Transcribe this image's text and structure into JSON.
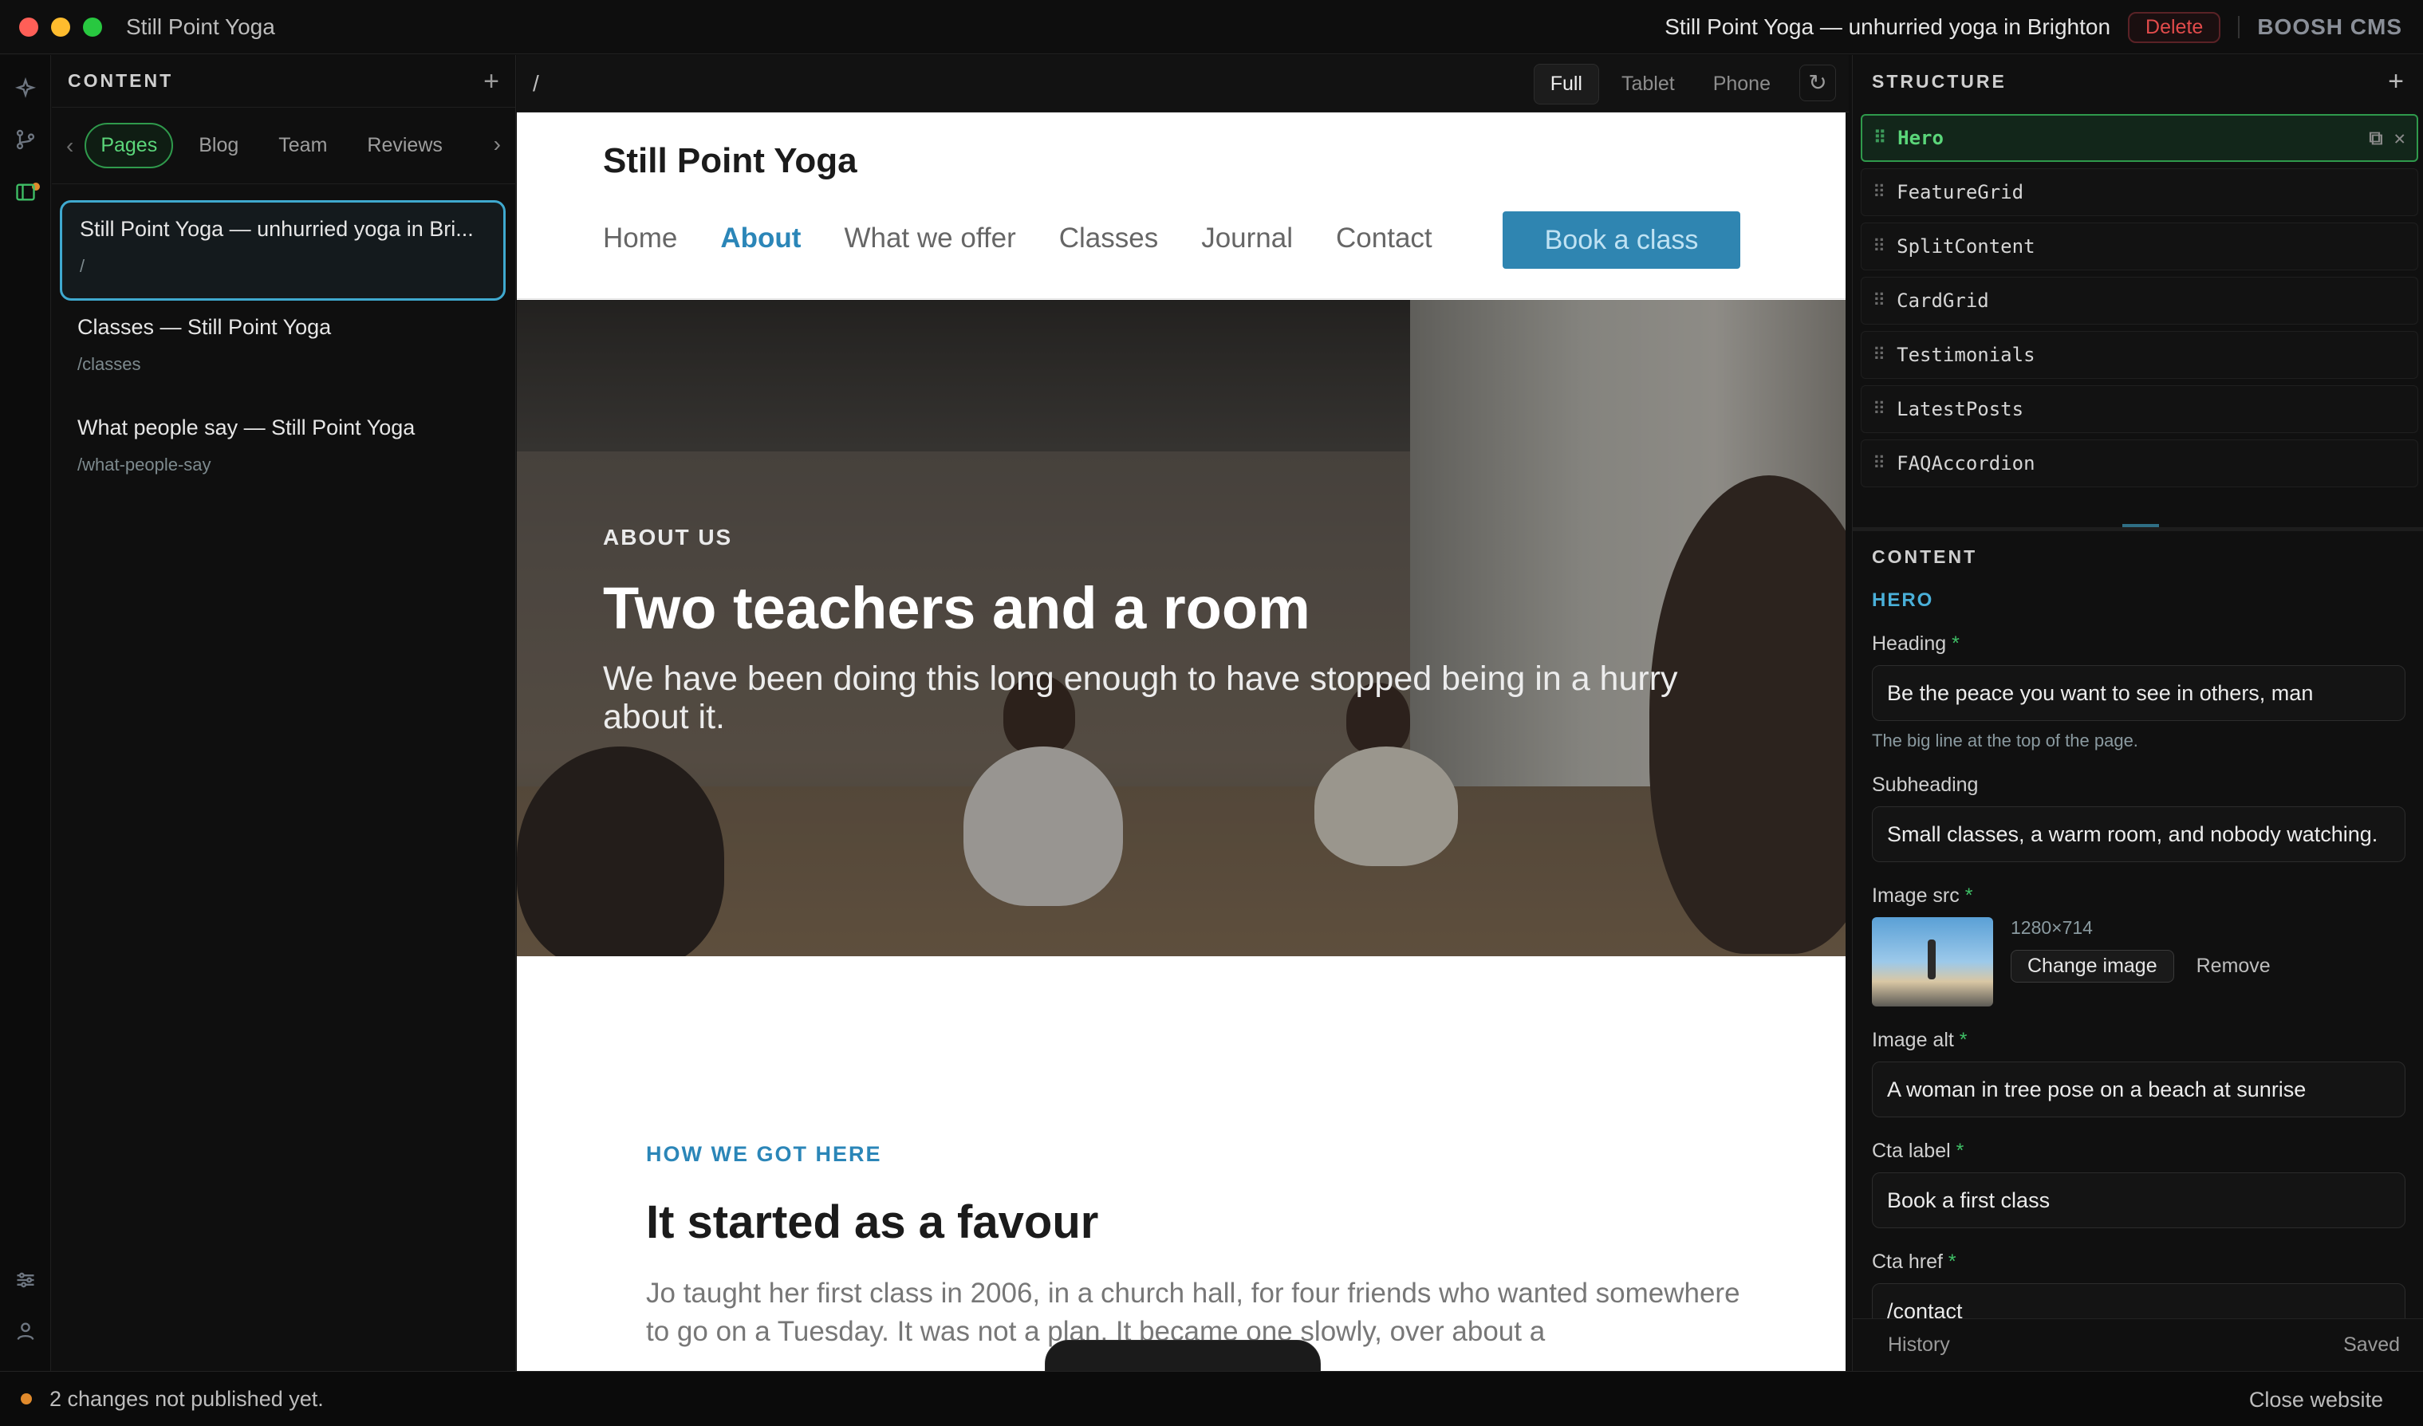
{
  "window": {
    "app_title": "Still Point Yoga",
    "page_title": "Still Point Yoga — unhurried yoga in Brighton",
    "delete_label": "Delete",
    "brand": "BOOSH CMS",
    "lights": [
      "#ff5f57",
      "#febc2e",
      "#28c840"
    ]
  },
  "rail": {
    "icons": [
      "sparkle-icon",
      "git-branch-icon",
      "sidebar-panel-icon",
      "sliders-icon",
      "user-icon"
    ]
  },
  "sidebar": {
    "title": "CONTENT",
    "add": "+",
    "tabs": [
      "Pages",
      "Blog",
      "Team",
      "Reviews"
    ],
    "active_tab": "Pages",
    "pages": [
      {
        "title": "Still Point Yoga — unhurried yoga in Bri...",
        "path": "/"
      },
      {
        "title": "Classes — Still Point Yoga",
        "path": "/classes"
      },
      {
        "title": "What people say — Still Point Yoga",
        "path": "/what-people-say"
      }
    ]
  },
  "preview_bar": {
    "path": "/",
    "viewports": [
      "Full",
      "Tablet",
      "Phone"
    ],
    "active_viewport": "Full"
  },
  "site": {
    "name": "Still Point Yoga",
    "nav": [
      "Home",
      "About",
      "What we offer",
      "Classes",
      "Journal",
      "Contact"
    ],
    "current_nav": "About",
    "cta": "Book a class",
    "hero": {
      "eyebrow": "ABOUT US",
      "title": "Two teachers and a room",
      "subtitle": "We have been doing this long enough to have stopped being in a hurry about it."
    },
    "story": {
      "eyebrow": "HOW WE GOT HERE",
      "title": "It started as a favour",
      "body": "Jo taught her first class in 2006, in a church hall, for four friends who wanted somewhere to go on a Tuesday. It was not a plan. It became one slowly, over about a"
    }
  },
  "structure": {
    "title": "STRUCTURE",
    "add": "+",
    "blocks": [
      "Hero",
      "FeatureGrid",
      "SplitContent",
      "CardGrid",
      "Testimonials",
      "LatestPosts",
      "FAQAccordion"
    ],
    "active_block": "Hero"
  },
  "content_panel": {
    "title": "CONTENT",
    "section": "HERO",
    "heading": {
      "label": "Heading",
      "value": "Be the peace you want to see in others, man",
      "hint": "The big line at the top of the page."
    },
    "subheading": {
      "label": "Subheading",
      "value": "Small classes, a warm room, and nobody watching."
    },
    "image_src": {
      "label": "Image src",
      "dimensions": "1280×714",
      "change": "Change image",
      "remove": "Remove"
    },
    "image_alt": {
      "label": "Image alt",
      "value": "A woman in tree pose on a beach at sunrise"
    },
    "cta_label": {
      "label": "Cta label",
      "value": "Book a first class"
    },
    "cta_href": {
      "label": "Cta href",
      "value": "/contact"
    },
    "required_mark": "*",
    "footer": {
      "history": "History",
      "status": "Saved"
    }
  },
  "statusbar": {
    "message": "2 changes not published yet.",
    "close": "Close website",
    "dot_color": "#e08a2c"
  },
  "colors": {
    "accent_green": "#5bd67a",
    "accent_blue": "#3fa9cf",
    "site_blue": "#2f85b1",
    "danger": "#e24b4b"
  }
}
